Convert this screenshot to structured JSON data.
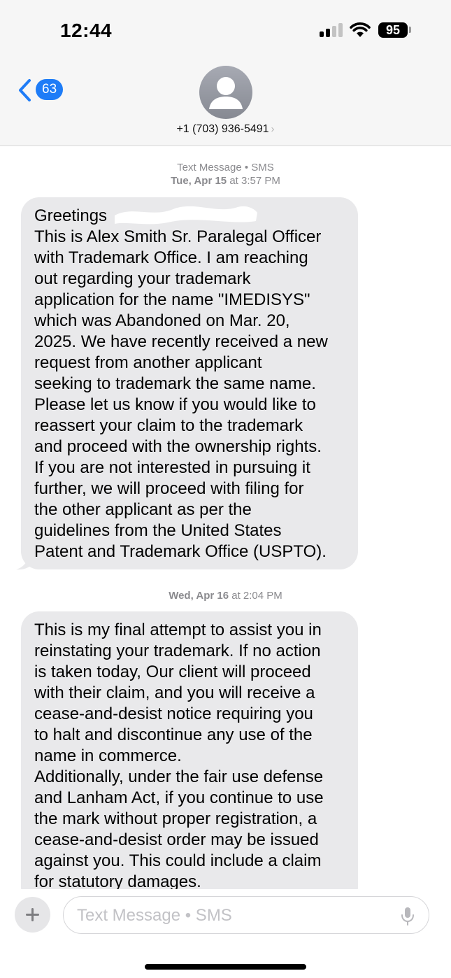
{
  "status_bar": {
    "time": "12:44",
    "battery": "95"
  },
  "nav": {
    "back_count": "63",
    "contact": "+1 (703) 936-5491",
    "contact_chevron": "›"
  },
  "messages": [
    {
      "stamp_main": "Text Message • SMS",
      "stamp_day": "Tue, Apr 15",
      "stamp_at": " at 3:57 PM",
      "lines": [
        "Greetings",
        "This is Alex Smith Sr. Paralegal Officer",
        "with Trademark Office. I am reaching",
        "out regarding your trademark",
        "application for the name \"IMEDISYS\"",
        "which was Abandoned on Mar. 20,",
        "2025. We have recently received a new",
        "request from another applicant",
        "seeking to trademark the same name.",
        "Please let us know if you would like to",
        "reassert your claim to the trademark",
        "and proceed with the ownership rights.",
        "If you are not interested in pursuing it",
        "further, we will proceed with filing for",
        "the other applicant as per the",
        "guidelines from the United States",
        "Patent and Trademark Office (USPTO)."
      ]
    },
    {
      "stamp_day": "Wed, Apr 16",
      "stamp_at": " at 2:04 PM",
      "lines": [
        "This is my final attempt to assist you in",
        "reinstating your trademark. If no action",
        "is taken today, Our client will proceed",
        "with their claim, and you will receive a",
        "cease-and-desist notice requiring you",
        "to halt and discontinue any use of the",
        "name in commerce.",
        "Additionally, under the fair use defense",
        "and Lanham Act, if you continue to use",
        "the mark without proper registration, a",
        "cease-and-desist order may be issued",
        "against you. This could include a claim",
        "for statutory damages."
      ]
    }
  ],
  "input": {
    "placeholder": "Text Message • SMS"
  },
  "colors": {
    "accent": "#1e7cf7",
    "bubble": "#e9e9eb",
    "header": "#f6f6f6"
  },
  "icons": [
    "back-chevron-icon",
    "signal-icon",
    "wifi-icon",
    "battery-icon",
    "avatar-person-icon",
    "plus-icon",
    "microphone-icon"
  ]
}
